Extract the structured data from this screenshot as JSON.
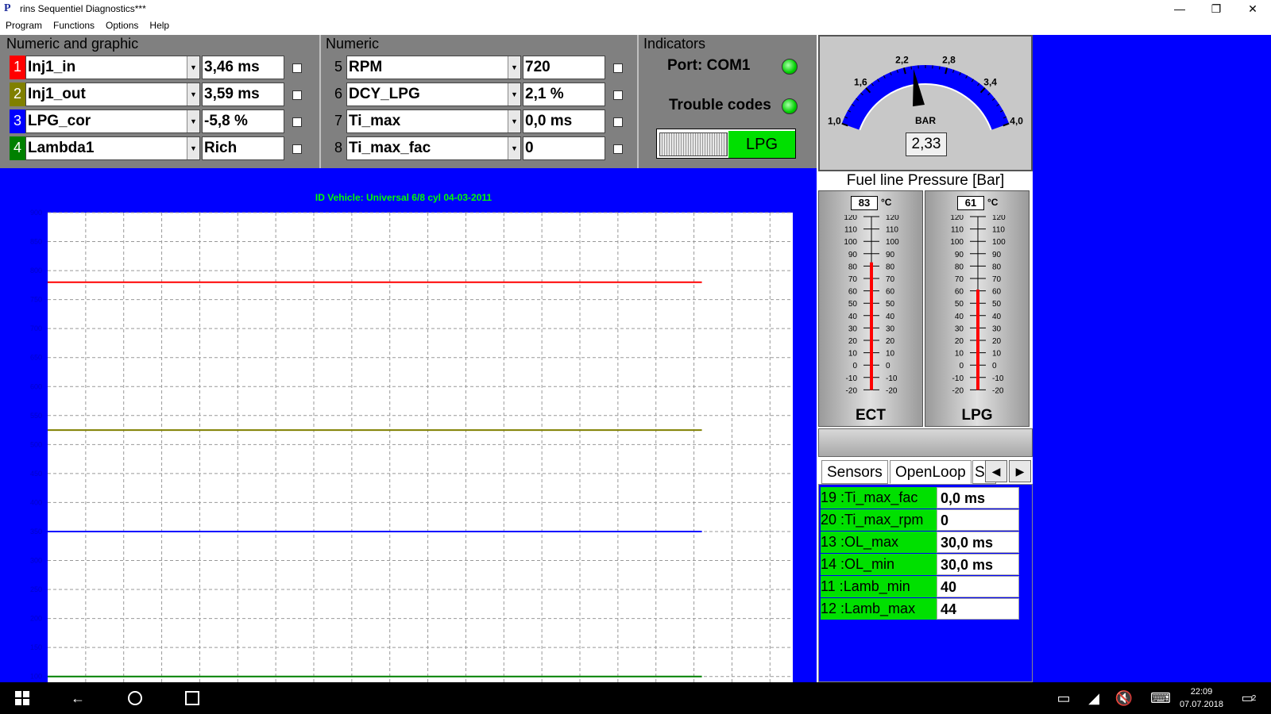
{
  "window": {
    "title": "rins Sequentiel Diagnostics***",
    "icon": "app-p-icon",
    "min": "—",
    "max": "❐",
    "close": "✕"
  },
  "menu": [
    "Program",
    "Functions",
    "Options",
    "Help"
  ],
  "groups": {
    "numeric_graphic": "Numeric and graphic",
    "numeric": "Numeric",
    "indicators": "Indicators"
  },
  "channels_left": [
    {
      "num": "1",
      "color": "#ff0000",
      "name": "Inj1_in",
      "value": "3,46 ms"
    },
    {
      "num": "2",
      "color": "#808000",
      "name": "Inj1_out",
      "value": "3,59 ms"
    },
    {
      "num": "3",
      "color": "#0000ff",
      "name": "LPG_cor",
      "value": "-5,8 %"
    },
    {
      "num": "4",
      "color": "#008000",
      "name": "Lambda1",
      "value": "Rich"
    }
  ],
  "channels_right": [
    {
      "num": "5",
      "name": "RPM",
      "value": "720"
    },
    {
      "num": "6",
      "name": "DCY_LPG",
      "value": "2,1 %"
    },
    {
      "num": "7",
      "name": "Ti_max",
      "value": "0,0 ms"
    },
    {
      "num": "8",
      "name": "Ti_max_fac",
      "value": "0"
    }
  ],
  "indicators": {
    "port": "Port: COM1",
    "trouble": "Trouble codes",
    "switch_label": "LPG"
  },
  "chart_data": {
    "type": "line",
    "title": "ID Vehicle: Universal 6/8 cyl 04-03-2011",
    "ylim": [
      100,
      900
    ],
    "yticks": [
      "900",
      "850",
      "800",
      "750",
      "700",
      "650",
      "600",
      "550",
      "500",
      "450",
      "400",
      "350",
      "300",
      "250",
      "200",
      "150",
      "100"
    ],
    "grid": true,
    "series": [
      {
        "color": "#ff0000",
        "values": [
          780,
          780
        ]
      },
      {
        "color": "#808000",
        "values": [
          525,
          525
        ]
      },
      {
        "color": "#0000ff",
        "values": [
          350,
          350
        ]
      },
      {
        "color": "#008000",
        "values": [
          100,
          100
        ]
      }
    ]
  },
  "gauge": {
    "ticks": [
      "1,0",
      "1,6",
      "2,2",
      "2,8",
      "3,4",
      "4,0"
    ],
    "unit": "BAR",
    "value": "2,33",
    "value_num": 2.33,
    "min": 1.0,
    "max": 4.0,
    "title": "Fuel line Pressure [Bar]"
  },
  "thermometers": [
    {
      "name": "ECT",
      "value": "83",
      "value_num": 83,
      "unit": "°C"
    },
    {
      "name": "LPG",
      "value": "61",
      "value_num": 61,
      "unit": "°C"
    }
  ],
  "thermo_scale": [
    "120",
    "110",
    "100",
    "90",
    "80",
    "70",
    "60",
    "50",
    "40",
    "30",
    "20",
    "10",
    "0",
    "-10",
    "-20"
  ],
  "tabs": [
    "Sensors",
    "OpenLoop",
    "S("
  ],
  "params": [
    {
      "name": "19 :Ti_max_fac",
      "value": "0,0 ms"
    },
    {
      "name": "20 :Ti_max_rpm",
      "value": "0"
    },
    {
      "name": "13 :OL_max",
      "value": "30,0 ms"
    },
    {
      "name": "14 :OL_min",
      "value": "30,0 ms"
    },
    {
      "name": "11 :Lamb_min",
      "value": "40"
    },
    {
      "name": "12 :Lamb_max",
      "value": "44"
    }
  ],
  "taskbar": {
    "time": "22:09",
    "date": "07.07.2018",
    "notif_count": "2"
  }
}
